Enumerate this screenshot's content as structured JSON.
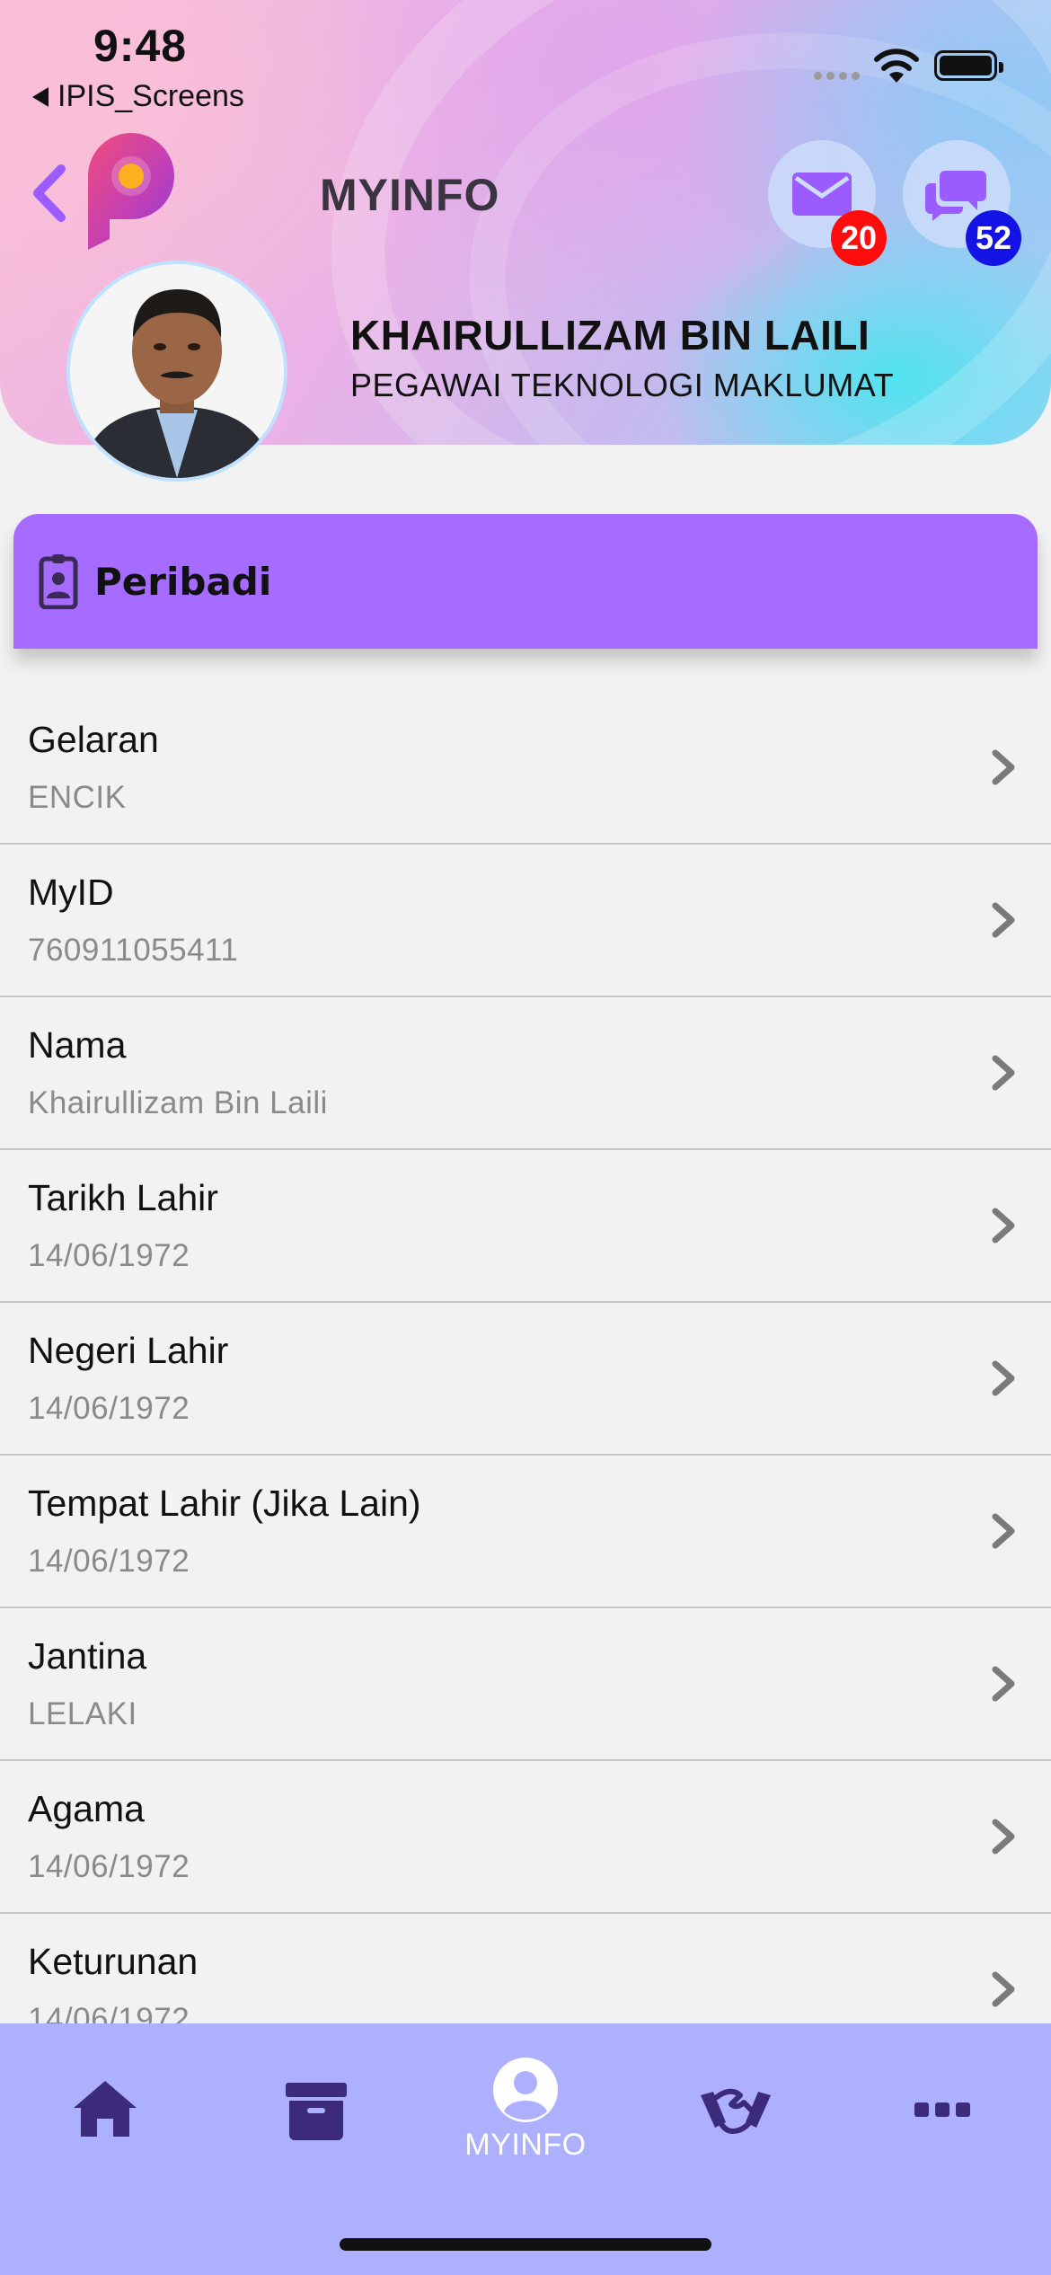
{
  "status_bar": {
    "time": "9:48",
    "back_app": "IPIS_Screens"
  },
  "header": {
    "title": "MYINFO",
    "mail_badge": "20",
    "chat_badge": "52",
    "accent_color": "#a66cff"
  },
  "profile": {
    "name": "KHAIRULLIZAM BIN LAILI",
    "role": "PEGAWAI TEKNOLOGI MAKLUMAT"
  },
  "section": {
    "title": "Peribadi",
    "icon": "id-badge-icon"
  },
  "fields": [
    {
      "label": "Gelaran",
      "value": "ENCIK"
    },
    {
      "label": "MyID",
      "value": "760911055411"
    },
    {
      "label": "Nama",
      "value": "Khairullizam Bin Laili"
    },
    {
      "label": "Tarikh Lahir",
      "value": "14/06/1972"
    },
    {
      "label": "Negeri Lahir",
      "value": "14/06/1972"
    },
    {
      "label": "Tempat Lahir (Jika Lain)",
      "value": "14/06/1972"
    },
    {
      "label": "Jantina",
      "value": "LELAKI"
    },
    {
      "label": "Agama",
      "value": "14/06/1972"
    },
    {
      "label": "Keturunan",
      "value": "14/06/1972"
    }
  ],
  "bottom_nav": {
    "items": [
      {
        "icon": "home-icon"
      },
      {
        "icon": "archive-icon"
      },
      {
        "icon": "user-circle-icon",
        "label": "MYINFO",
        "active": true
      },
      {
        "icon": "handshake-icon"
      },
      {
        "icon": "more-icon"
      }
    ]
  }
}
